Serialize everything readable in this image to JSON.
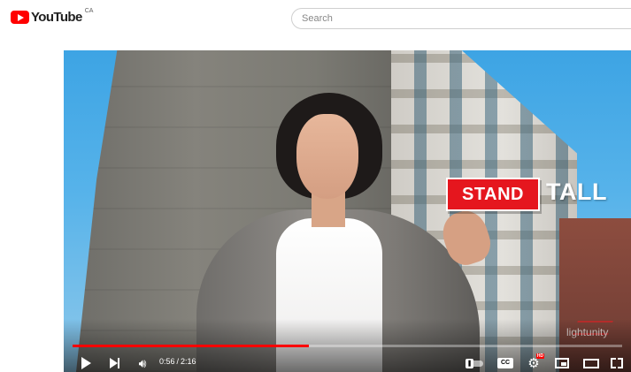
{
  "header": {
    "logo_text": "YouTube",
    "country_code": "CA",
    "search_placeholder": "Search"
  },
  "video": {
    "overlay_title_part1": "STAND",
    "overlay_title_part2": "TALL",
    "watermark": "lightunity",
    "progress_fraction": 0.43,
    "brand_color": "#ff0000"
  },
  "controls": {
    "current_time": "0:56",
    "duration": "2:16",
    "cc_label": "CC",
    "hd_badge": "HD",
    "icons": [
      "play-icon",
      "next-icon",
      "volume-icon",
      "autoplay-toggle",
      "subtitles-icon",
      "settings-icon",
      "miniplayer-icon",
      "theater-icon",
      "fullscreen-icon"
    ]
  }
}
